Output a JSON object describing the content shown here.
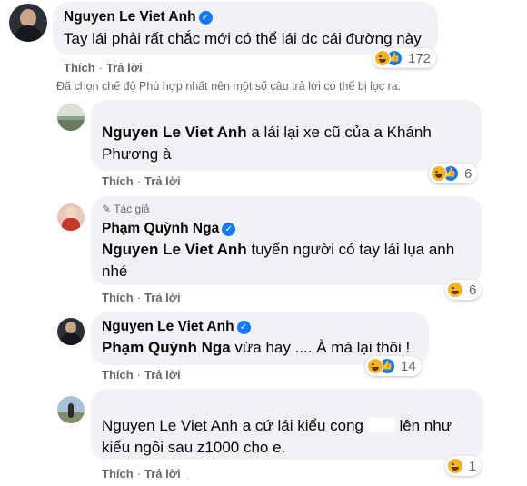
{
  "top_comment": {
    "author": "Nguyen Le Viet Anh",
    "text": "Tay lái phải rất chắc mới có thể lái dc cái đường này",
    "like_label": "Thích",
    "reply_label": "Trả lời",
    "reaction_count": "172"
  },
  "filter_notice": "Đã chọn chế độ Phù hợp nhất nên một số câu trả lời có thể bị lọc ra.",
  "replies": [
    {
      "author": "Nguyen Le Viet Anh",
      "mention": "",
      "text_part1": "Nguyen Le Viet Anh",
      "text_part2": " a lái lại xe cũ của a Khánh Phương à",
      "like_label": "Thích",
      "reply_label": "Trả lời",
      "reaction_count": "6"
    },
    {
      "author_badge": "Tác giả",
      "author": "Phạm Quỳnh Nga",
      "mention": "Nguyen Le Viet Anh",
      "text": " tuyển người có tay lái lụa anh nhé",
      "like_label": "Thích",
      "reply_label": "Trả lời",
      "reaction_count": "6"
    },
    {
      "author": "Nguyen Le Viet Anh",
      "mention": "Phạm Quỳnh Nga",
      "text": " vừa hay .... À mà lại thôi !",
      "like_label": "Thích",
      "reply_label": "Trả lời",
      "reaction_count": "14"
    },
    {
      "mention": "Nguyen Le Viet Anh",
      "text_a": " a cứ lái kiểu cong ",
      "text_b": " lên như kiểu ngồi sau z1000 cho e.",
      "like_label": "Thích",
      "reply_label": "Trả lời",
      "reaction_count": "1"
    }
  ],
  "colors": {
    "bubble": "#f0f2f5",
    "secondary_text": "#65676b",
    "verified_blue": "#1877f2",
    "haha_yellow": "#f7b125"
  }
}
